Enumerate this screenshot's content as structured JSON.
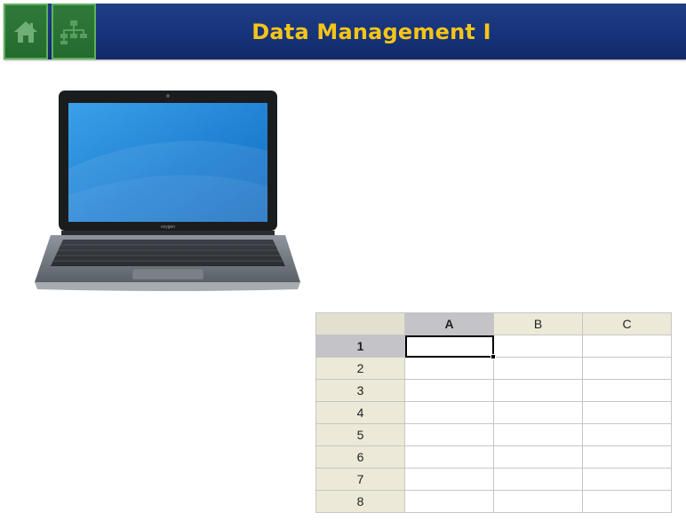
{
  "header": {
    "title": "Data Management I",
    "home_icon": "home-icon",
    "sitemap_icon": "sitemap-icon",
    "colors": {
      "bar": "#17337a",
      "title": "#f5c518",
      "nav_button": "#2a7435"
    }
  },
  "laptop": {
    "brand": "oxygen"
  },
  "spreadsheet": {
    "columns": [
      "A",
      "B",
      "C"
    ],
    "rows": [
      "1",
      "2",
      "3",
      "4",
      "5",
      "6",
      "7",
      "8"
    ],
    "active_cell": "A1"
  }
}
